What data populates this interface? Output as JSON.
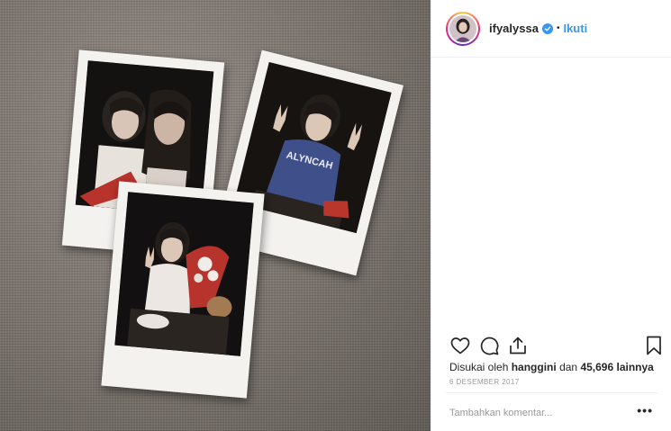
{
  "post": {
    "username": "ifyalyssa",
    "follow_label": "Ikuti",
    "separator": "•",
    "likes": {
      "prefix": "Disukai oleh",
      "user": "hanggini",
      "and": "dan",
      "count": "45,696",
      "suffix": "lainnya"
    },
    "date": "6 DESEMBER 2017",
    "comment_placeholder": "Tambahkan komentar...",
    "more_label": "•••",
    "photo": {
      "shirt_text": "ALYNCAH"
    }
  },
  "colors": {
    "link": "#3897f0",
    "verified": "#3897f0",
    "muted": "#999999",
    "text": "#262626"
  },
  "icons": [
    "heart-icon",
    "comment-icon",
    "share-icon",
    "bookmark-icon",
    "verified-icon",
    "more-icon"
  ]
}
